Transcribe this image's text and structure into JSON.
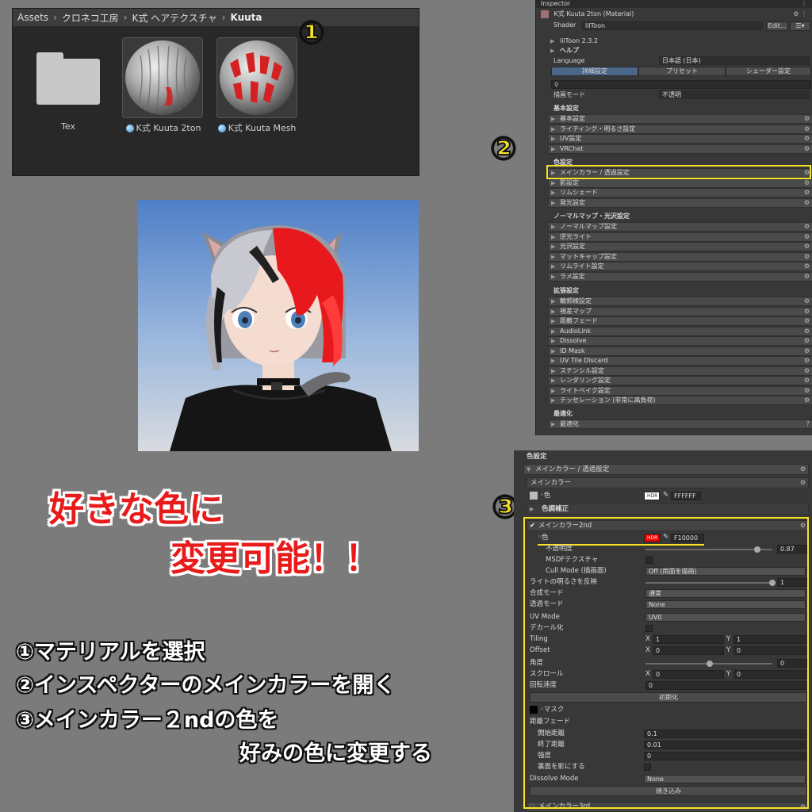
{
  "project": {
    "breadcrumb": [
      "Assets",
      "クロネコ工房",
      "K式 ヘアテクスチャ",
      "Kuuta"
    ],
    "items": [
      {
        "label": "Tex",
        "icon": "folder-icon"
      },
      {
        "label": "K式 Kuuta 2ton",
        "icon": "material-icon"
      },
      {
        "label": "K式 Kuuta Mesh",
        "icon": "material-icon"
      }
    ]
  },
  "markers": {
    "one": "①",
    "two": "②",
    "three": "③"
  },
  "inspector": {
    "tab": "Inspector",
    "material_title": "K式 Kuuta 2ton (Material)",
    "shader_label": "Shader",
    "shader_value": "lilToon",
    "edit_button": "Edit...",
    "version": "lilToon 2.3.2",
    "help": "ヘルプ",
    "language_label": "Language",
    "language_value": "日本語 (日本)",
    "tabs": [
      "詳細設定",
      "プリセット",
      "シェーダー設定"
    ],
    "render_mode_label": "描画モード",
    "render_mode_value": "不透明",
    "groups": [
      {
        "title": "基本設定",
        "items": [
          "基本設定",
          "ライティング・明るさ設定",
          "UV設定",
          "VRChat"
        ]
      },
      {
        "title": "色設定",
        "items": [
          "メインカラー / 透過設定",
          "影設定",
          "リムシェード",
          "発光設定"
        ]
      },
      {
        "title": "ノーマルマップ・光沢設定",
        "items": [
          "ノーマルマップ設定",
          "逆光ライト",
          "光沢設定",
          "マットキャップ設定",
          "リムライト設定",
          "ラメ設定"
        ]
      },
      {
        "title": "拡張設定",
        "items": [
          "輪郭線設定",
          "視差マップ",
          "距離フェード",
          "AudioLink",
          "Dissolve",
          "ID Mask",
          "UV Tile Discard",
          "ステンシル設定",
          "レンダリング設定",
          "ライトベイク設定",
          "テッセレーション (非常に高負荷)"
        ]
      },
      {
        "title": "最適化",
        "items": [
          "最適化"
        ]
      }
    ]
  },
  "panel3": {
    "section": "色設定",
    "foldout": "メインカラー / 透過設定",
    "main_color_header": "メインカラー",
    "color_label": "色",
    "hdr": "HDR",
    "main_hex": "FFFFFF",
    "color_adjust": "色調補正",
    "main2_header": "メインカラー2nd",
    "main2_hex": "F10000",
    "opacity_label": "不透明度",
    "opacity_value": "0.87",
    "msdf_label": "MSDFテクスチャ",
    "cull_label": "Cull Mode (描画面)",
    "cull_value": "Off (両面を描画)",
    "light_invert_label": "ライトの明るさを反映",
    "light_invert_value": "1",
    "blend_label": "合成モード",
    "blend_value": "通常",
    "alpha_label": "透過モード",
    "alpha_value": "None",
    "uvmode_label": "UV Mode",
    "uvmode_value": "UV0",
    "decal_label": "デカール化",
    "tiling_label": "Tiling",
    "tiling_x": "1",
    "tiling_y": "1",
    "offset_label": "Offset",
    "offset_x": "0",
    "offset_y": "0",
    "angle_label": "角度",
    "angle_value": "0",
    "scroll_label": "スクロール",
    "scroll_x": "0",
    "scroll_y": "0",
    "rotate_label": "回転速度",
    "rotate_value": "0",
    "reset_button": "初期化",
    "mask_label": "マスク",
    "fade_label": "距離フェード",
    "fade_start_label": "開始距離",
    "fade_start": "0.1",
    "fade_end_label": "終了距離",
    "fade_end": "0.01",
    "fade_strength_label": "強度",
    "fade_strength": "0",
    "backface_label": "裏面を影にする",
    "dissolve_label": "Dissolve Mode",
    "dissolve_value": "None",
    "bake_button": "焼き込み",
    "main3_header": "メインカラー3rd",
    "x": "X",
    "y": "Y"
  },
  "headline": {
    "line1": "好きな色に",
    "line2": "変更可能！！"
  },
  "steps": [
    "①マテリアルを選択",
    "②インスペクターのメインカラーを開く",
    "③メインカラー２ndの色を",
    "好みの色に変更する"
  ],
  "colors": {
    "highlight": "#f6e127",
    "accent_red": "#e81a1a",
    "main2_color": "#f10000"
  }
}
